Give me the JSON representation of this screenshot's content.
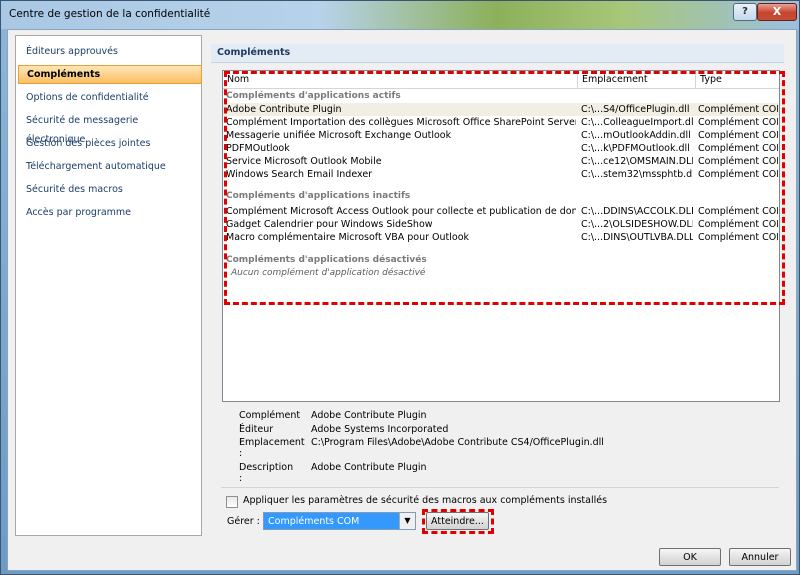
{
  "window": {
    "title": "Centre de gestion de la confidentialité",
    "help": "?",
    "close": "X"
  },
  "nav": {
    "items": [
      {
        "label": "Éditeurs approuvés"
      },
      {
        "label": "Compléments"
      },
      {
        "label": "Options de confidentialité"
      },
      {
        "label": "Sécurité de messagerie électronique"
      },
      {
        "label": "Gestion des pièces jointes"
      },
      {
        "label": "Téléchargement automatique"
      },
      {
        "label": "Sécurité des macros"
      },
      {
        "label": "Accès par programme"
      }
    ]
  },
  "section": {
    "title": "Compléments"
  },
  "list": {
    "columns": {
      "name": "Nom",
      "location": "Emplacement",
      "type": "Type"
    },
    "groups": {
      "active": "Compléments d'applications actifs",
      "inactive": "Compléments d'applications inactifs",
      "disabled": "Compléments d'applications désactivés",
      "disabled_empty": "Aucun complément d'application désactivé"
    },
    "active_rows": [
      {
        "name": "Adobe Contribute Plugin",
        "location": "C:\\...S4/OfficePlugin.dll",
        "type": "Complément COM"
      },
      {
        "name": "Complément Importation des collègues Microsoft Office SharePoint Server",
        "location": "C:\\...ColleagueImport.dll",
        "type": "Complément COM"
      },
      {
        "name": "Messagerie unifiée Microsoft Exchange Outlook",
        "location": "C:\\...mOutlookAddin.dll",
        "type": "Complément COM"
      },
      {
        "name": "PDFMOutlook",
        "location": "C:\\...k\\PDFMOutlook.dll",
        "type": "Complément COM"
      },
      {
        "name": "Service Microsoft Outlook Mobile",
        "location": "C:\\...ce12\\OMSMAIN.DLL",
        "type": "Complément COM"
      },
      {
        "name": "Windows Search Email Indexer",
        "location": "C:\\...stem32\\mssphtb.dll",
        "type": "Complément COM"
      }
    ],
    "inactive_rows": [
      {
        "name": "Complément Microsoft Access Outlook pour collecte et publication de données",
        "location": "C:\\...DDINS\\ACCOLK.DLL",
        "type": "Complément COM"
      },
      {
        "name": "Gadget Calendrier pour Windows SideShow",
        "location": "C:\\...2\\OLSIDESHOW.DLL",
        "type": "Complément COM"
      },
      {
        "name": "Macro complémentaire Microsoft VBA pour Outlook",
        "location": "C:\\...DINS\\OUTLVBA.DLL",
        "type": "Complément COM"
      }
    ]
  },
  "details": {
    "addin_label": "Complément :",
    "addin_value": "Adobe Contribute Plugin",
    "publisher_label": "Éditeur :",
    "publisher_value": "Adobe Systems Incorporated",
    "location_label": "Emplacement :",
    "location_value": "C:\\Program Files\\Adobe\\Adobe Contribute CS4/OfficePlugin.dll",
    "description_label": "Description :",
    "description_value": "Adobe Contribute Plugin"
  },
  "options": {
    "apply_macro_label": "Appliquer les paramètres de sécurité des macros aux compléments installés",
    "apply_macro_checked": false,
    "manage_label": "Gérer :",
    "manage_selected": "Compléments COM",
    "go_button": "Atteindre..."
  },
  "footer": {
    "ok": "OK",
    "cancel": "Annuler"
  },
  "colors": {
    "highlight": "#e00000",
    "select_bg": "#3399ff",
    "nav_active": "#fbbe62"
  }
}
